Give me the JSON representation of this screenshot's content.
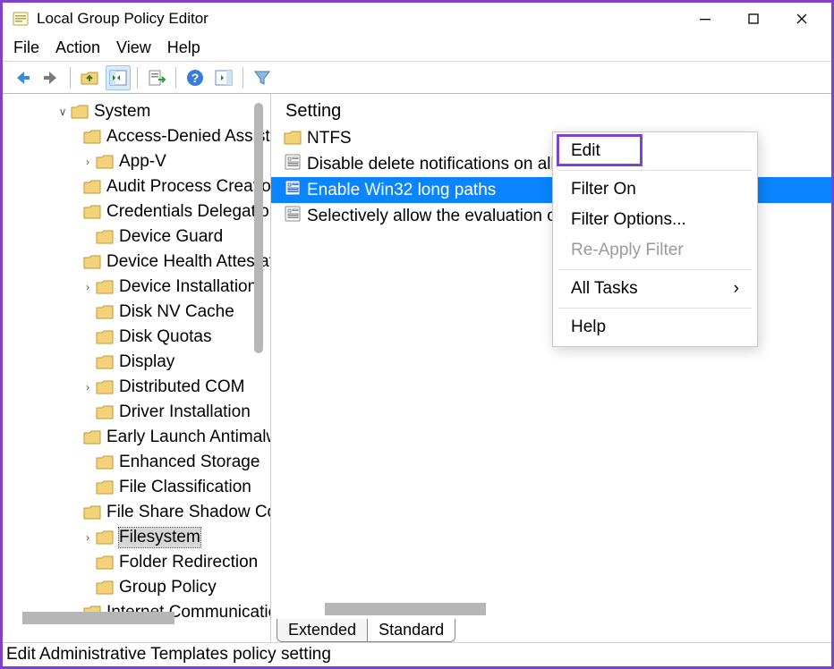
{
  "title": "Local Group Policy Editor",
  "menubar": [
    "File",
    "Action",
    "View",
    "Help"
  ],
  "tree": {
    "root": {
      "label": "System",
      "expanded": true
    },
    "children": [
      {
        "label": "Access-Denied Assistance"
      },
      {
        "label": "App-V",
        "expandable": true
      },
      {
        "label": "Audit Process Creation"
      },
      {
        "label": "Credentials Delegation"
      },
      {
        "label": "Device Guard"
      },
      {
        "label": "Device Health Attestation"
      },
      {
        "label": "Device Installation",
        "expandable": true
      },
      {
        "label": "Disk NV Cache"
      },
      {
        "label": "Disk Quotas"
      },
      {
        "label": "Display"
      },
      {
        "label": "Distributed COM",
        "expandable": true
      },
      {
        "label": "Driver Installation"
      },
      {
        "label": "Early Launch Antimalware"
      },
      {
        "label": "Enhanced Storage"
      },
      {
        "label": "File Classification"
      },
      {
        "label": "File Share Shadow Copy"
      },
      {
        "label": "Filesystem",
        "expandable": true,
        "selected": true
      },
      {
        "label": "Folder Redirection"
      },
      {
        "label": "Group Policy"
      },
      {
        "label": "Internet Communication"
      }
    ]
  },
  "list": {
    "header": "Setting",
    "items": [
      {
        "type": "folder",
        "label": "NTFS"
      },
      {
        "type": "setting",
        "label": "Disable delete notifications on all volumes"
      },
      {
        "type": "setting",
        "label": "Enable Win32 long paths",
        "selected": true
      },
      {
        "type": "setting",
        "label": "Selectively allow the evaluation of symbolic links"
      }
    ]
  },
  "tabs": [
    "Extended",
    "Standard"
  ],
  "active_tab": 1,
  "context_menu": {
    "items": [
      {
        "label": "Edit",
        "highlight": true
      },
      {
        "sep": true
      },
      {
        "label": "Filter On"
      },
      {
        "label": "Filter Options..."
      },
      {
        "label": "Re-Apply Filter",
        "disabled": true
      },
      {
        "sep": true
      },
      {
        "label": "All Tasks",
        "submenu": true
      },
      {
        "sep": true
      },
      {
        "label": "Help"
      }
    ]
  },
  "statusbar": "Edit Administrative Templates policy setting"
}
